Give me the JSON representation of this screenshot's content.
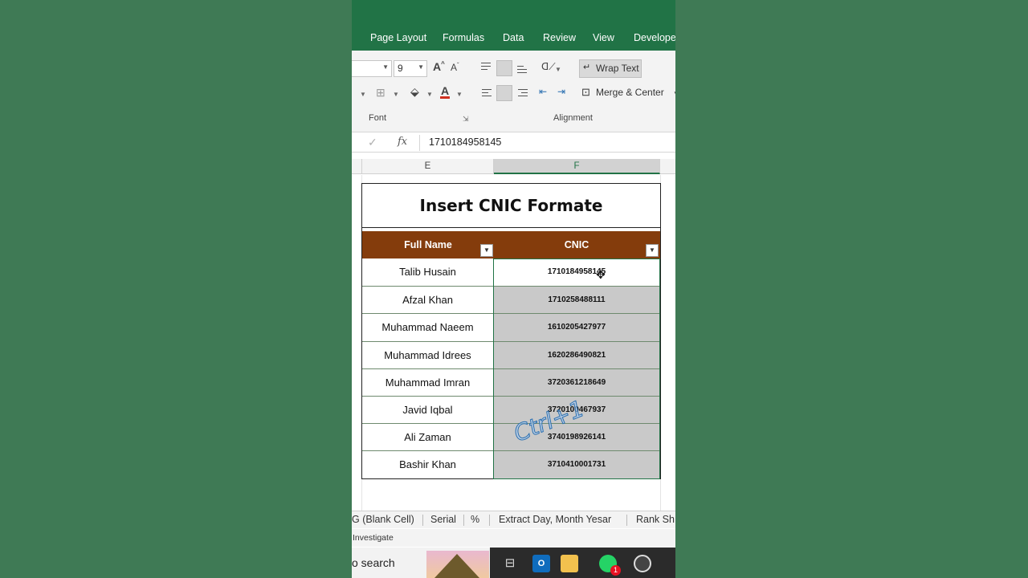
{
  "ribbon_tabs": [
    "Page Layout",
    "Formulas",
    "Data",
    "Review",
    "View",
    "Developer"
  ],
  "font_size": "9",
  "groups": {
    "font": "Font",
    "alignment": "Alignment"
  },
  "buttons": {
    "wrap_text": "Wrap Text",
    "merge_center": "Merge & Center"
  },
  "formula_bar": {
    "fx": "fx",
    "value": "1710184958145"
  },
  "columns": [
    "E",
    "F"
  ],
  "table": {
    "title": "Insert CNIC Formate",
    "headers": [
      "Full Name",
      "CNIC"
    ],
    "rows": [
      {
        "name": "Talib Husain",
        "cnic": "1710184958145"
      },
      {
        "name": "Afzal Khan",
        "cnic": "1710258488111"
      },
      {
        "name": "Muhammad Naeem",
        "cnic": "1610205427977"
      },
      {
        "name": "Muhammad Idrees",
        "cnic": "1620286490821"
      },
      {
        "name": "Muhammad Imran",
        "cnic": "3720361218649"
      },
      {
        "name": "Javid Iqbal",
        "cnic": "3720100467937"
      },
      {
        "name": "Ali Zaman",
        "cnic": "3740198926141"
      },
      {
        "name": "Bashir Khan",
        "cnic": "3710410001731"
      }
    ]
  },
  "overlay_text": "Ctrl+1",
  "sheet_tabs": [
    "G (Blank Cell)",
    "Serial",
    "%",
    "Extract Day, Month Yesar",
    "Rank Sh"
  ],
  "status_text": "Investigate",
  "taskbar": {
    "search_text": "o search",
    "notification_count": "1"
  },
  "colors": {
    "excel_green": "#217346",
    "header_brown": "#843c0c",
    "selection_gray": "#c9c9c9"
  }
}
